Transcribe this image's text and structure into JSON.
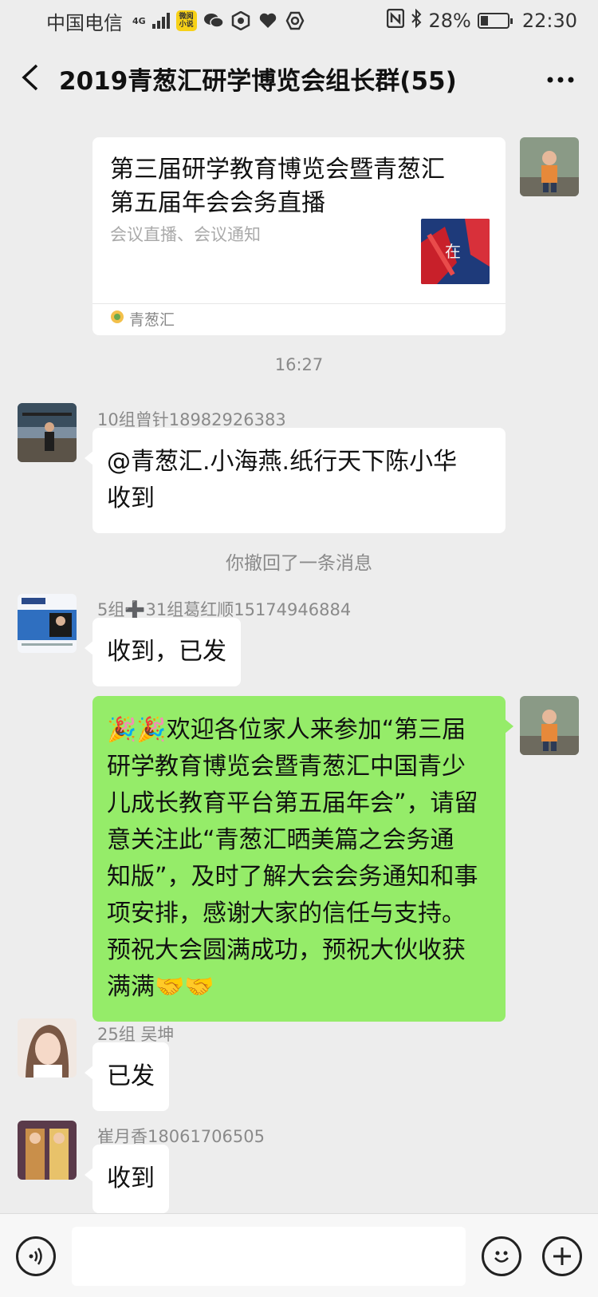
{
  "status_bar": {
    "carrier": "中国电信",
    "network": "4G",
    "app_badge": "微阅小说",
    "battery": "28%",
    "time": "22:30"
  },
  "header": {
    "title": "2019青葱汇研学博览会组长群(55)"
  },
  "card": {
    "title": "第三届研学教育博览会暨青葱汇第五届年会会务直播",
    "desc": "会议直播、会议通知",
    "thumb_text": "在",
    "source": "青葱汇"
  },
  "timestamp": "16:27",
  "recall_notice": "你撤回了一条消息",
  "messages": [
    {
      "sender": "10组曾针18982926383",
      "text_line1": "@青葱汇.小海燕.纸行天下陈小华",
      "text_line2": "收到"
    },
    {
      "sender": "5组➕31组葛红顺15174946884",
      "text": "收到，已发"
    },
    {
      "sender": "25组 吴坤",
      "text": "已发"
    },
    {
      "sender": "崔月香18061706505",
      "text": "收到"
    }
  ],
  "my_message": {
    "lines": [
      "🎉🎉欢迎各位家人来参加“第三届",
      "研学教育博览会暨青葱汇中国青少",
      "儿成长教育平台第五届年会”，请留",
      "意关注此“青葱汇晒美篇之会务通",
      "知版”，及时了解大会会务通知和事",
      "项安排，感谢大家的信任与支持。",
      "预祝大会圆满成功，预祝大伙收获",
      "满满🤝🤝"
    ]
  },
  "colors": {
    "bg": "#ededed",
    "my_bubble": "#95ec69",
    "other_bubble": "#ffffff"
  },
  "battery_level": 0.28
}
